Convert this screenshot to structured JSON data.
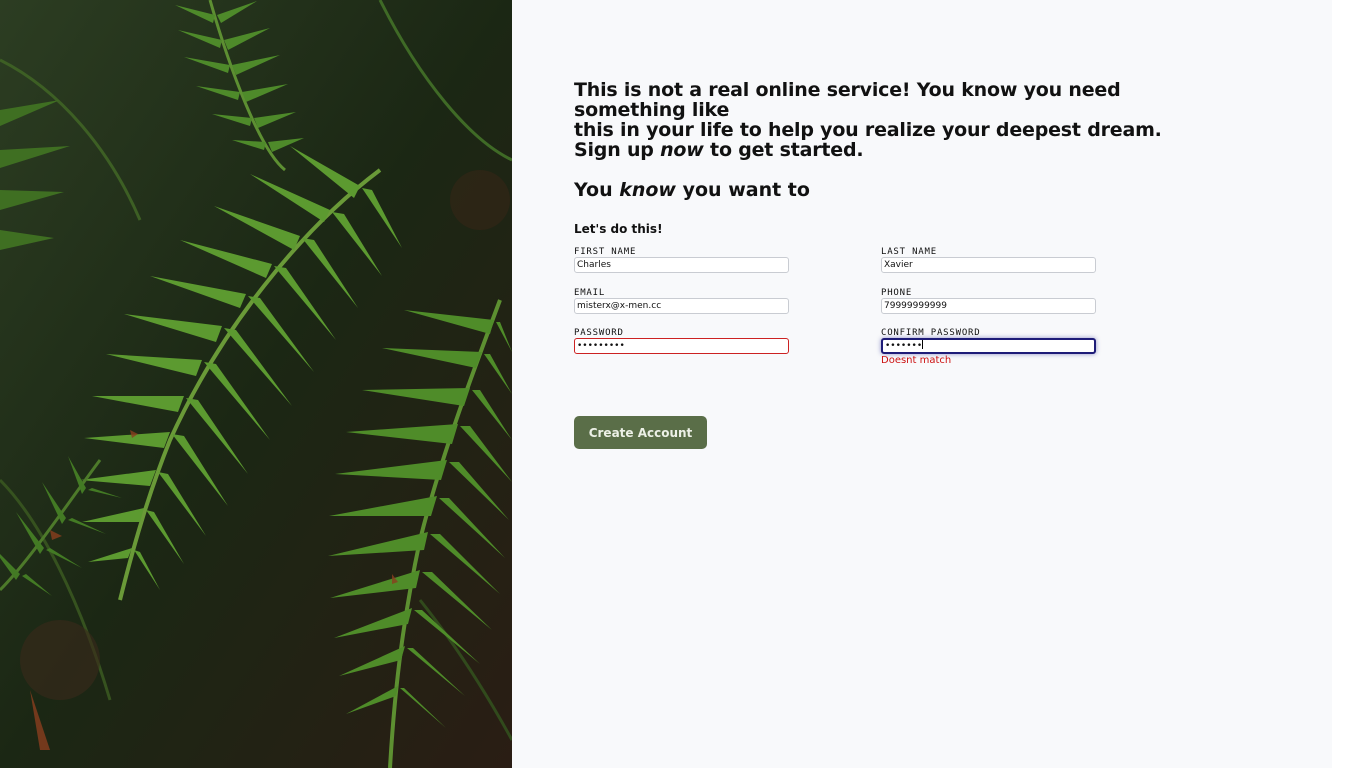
{
  "hero": {
    "image": "fern-leaves-photo"
  },
  "intro": {
    "line1": "This is not a real online service! You know you need something like",
    "line2": "this in your life to help you realize your deepest dream.",
    "line3_before": "Sign up ",
    "line3_em": "now",
    "line3_after": " to get started."
  },
  "tagline": {
    "before": "You ",
    "em": "know",
    "after": " you want to"
  },
  "form": {
    "subheading": "Let's do this!",
    "first_name": {
      "label": "FIRST NAME",
      "value": "Charles"
    },
    "last_name": {
      "label": "LAST NAME",
      "value": "Xavier"
    },
    "email": {
      "label": "EMAIL",
      "value": "misterx@x-men.cc"
    },
    "phone": {
      "label": "PHONE",
      "value": "79999999999"
    },
    "password": {
      "label": "PASSWORD",
      "value": "•••••••••"
    },
    "confirm_password": {
      "label": "CONFIRM PASSWORD",
      "value": "•••••••",
      "error": "Doesnt match"
    },
    "submit_label": "Create Account"
  },
  "colors": {
    "panel_bg": "#f8f9fb",
    "button_bg": "#5a6e48",
    "error": "#cc1111",
    "focus_border": "#1e1c78"
  }
}
